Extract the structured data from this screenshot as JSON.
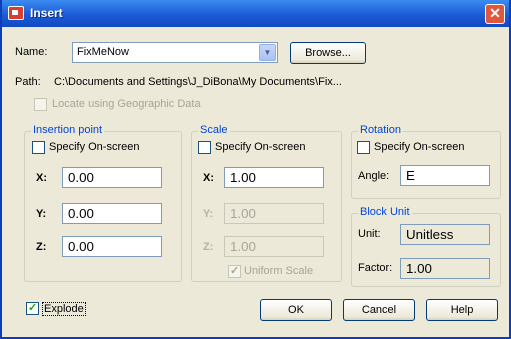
{
  "window": {
    "title": "Insert"
  },
  "name_field": {
    "label": "Name:",
    "value": "FixMeNow",
    "browse_label": "Browse..."
  },
  "path": {
    "label": "Path:",
    "value": "C:\\Documents and Settings\\J_DiBona\\My Documents\\Fix..."
  },
  "geo": {
    "label": "Locate using Geographic Data",
    "checked": false,
    "enabled": false
  },
  "insertion_point": {
    "title": "Insertion point",
    "specify_label": "Specify On-screen",
    "specify_checked": false,
    "x_label": "X:",
    "x_value": "0.00",
    "y_label": "Y:",
    "y_value": "0.00",
    "z_label": "Z:",
    "z_value": "0.00"
  },
  "scale": {
    "title": "Scale",
    "specify_label": "Specify On-screen",
    "specify_checked": false,
    "x_label": "X:",
    "x_value": "1.00",
    "y_label": "Y:",
    "y_value": "1.00",
    "z_label": "Z:",
    "z_value": "1.00",
    "uniform_label": "Uniform Scale",
    "uniform_checked": true
  },
  "rotation": {
    "title": "Rotation",
    "specify_label": "Specify On-screen",
    "specify_checked": false,
    "angle_label": "Angle:",
    "angle_value": "E"
  },
  "block_unit": {
    "title": "Block Unit",
    "unit_label": "Unit:",
    "unit_value": "Unitless",
    "factor_label": "Factor:",
    "factor_value": "1.00"
  },
  "explode": {
    "label": "Explode",
    "checked": true
  },
  "buttons": {
    "ok": "OK",
    "cancel": "Cancel",
    "help": "Help"
  },
  "colors": {
    "titlebar": "#1c5bd6",
    "dialog_bg": "#ece9d8",
    "group_title": "#0046d5",
    "check_mark": "#21a121"
  }
}
